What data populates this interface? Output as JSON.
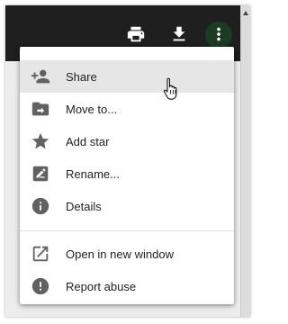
{
  "toolbar": {
    "icons": [
      "print-icon",
      "download-icon",
      "more-vert-icon"
    ]
  },
  "menu": {
    "items": [
      {
        "label": "Share",
        "icon": "person-add-icon"
      },
      {
        "label": "Move to...",
        "icon": "move-to-folder-icon"
      },
      {
        "label": "Add star",
        "icon": "star-icon"
      },
      {
        "label": "Rename...",
        "icon": "rename-icon"
      },
      {
        "label": "Details",
        "icon": "info-icon"
      },
      {
        "label": "Open in new window",
        "icon": "open-in-new-icon"
      },
      {
        "label": "Report abuse",
        "icon": "report-icon"
      }
    ]
  },
  "colors": {
    "topbar": "#1f1f1f",
    "icon": "#616161",
    "hover": "#e6e6e6",
    "text": "#222222"
  }
}
